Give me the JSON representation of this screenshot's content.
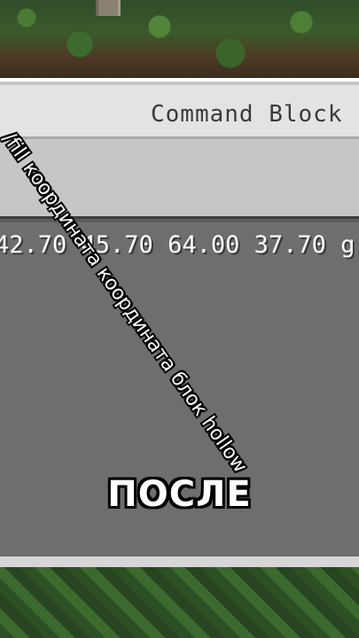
{
  "window": {
    "title": "Command Block"
  },
  "editor": {
    "command_text": "42.70 45.70 64.00 37.70 g"
  },
  "overlay": {
    "diagonal_caption": "/fill координата координата блок hollow",
    "after_label": "ПОСЛЕ"
  },
  "colors": {
    "frame": "#c6c6c6",
    "editor_bg": "#6e6e6e",
    "text": "#ffffff",
    "grass": "#2f5226"
  }
}
